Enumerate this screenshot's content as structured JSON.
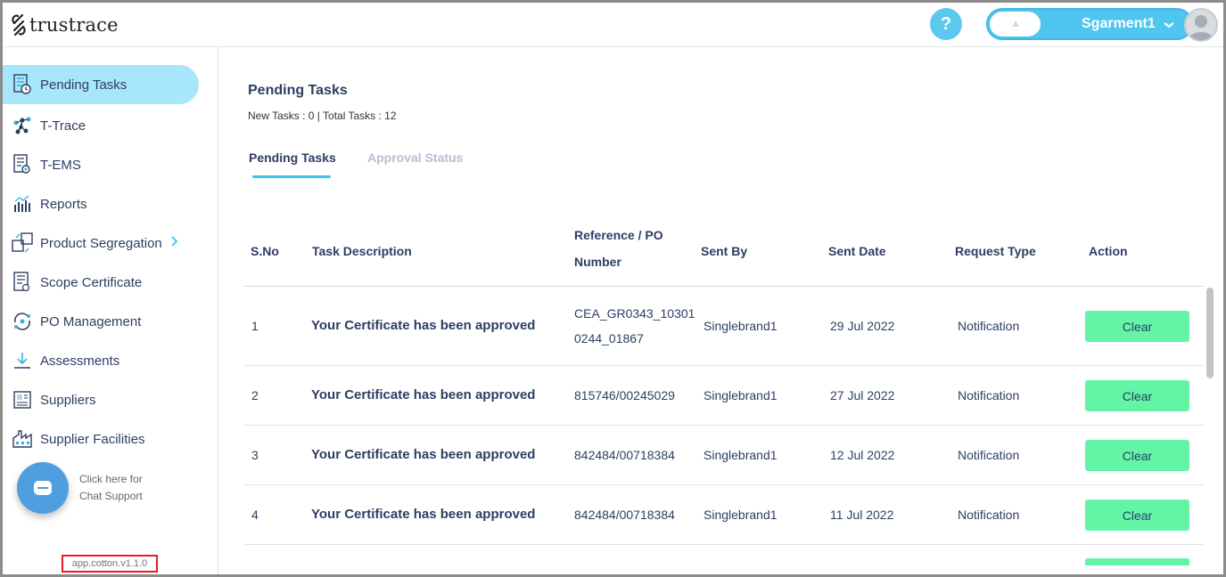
{
  "header": {
    "logo_text": "trustrace",
    "help_label": "?",
    "account_name": "Sgarment1",
    "account_chevron": "chevron-down-icon"
  },
  "sidebar": {
    "items": [
      {
        "label": "Pending Tasks",
        "icon": "clipboard-clock-icon",
        "active": true
      },
      {
        "label": "T-Trace",
        "icon": "network-nodes-icon"
      },
      {
        "label": "T-EMS",
        "icon": "document-badge-icon"
      },
      {
        "label": "Reports",
        "icon": "chart-icon"
      },
      {
        "label": "Product Segregation",
        "icon": "segregation-icon",
        "has_submenu": true
      },
      {
        "label": "Scope Certificate",
        "icon": "certificate-icon"
      },
      {
        "label": "PO Management",
        "icon": "po-cycle-icon"
      },
      {
        "label": "Assessments",
        "icon": "download-icon"
      },
      {
        "label": "Suppliers",
        "icon": "supplier-card-icon"
      },
      {
        "label": "Supplier Facilities",
        "icon": "factory-icon"
      }
    ],
    "chat_line1": "Click here for",
    "chat_line2": "Chat Support",
    "version": "app.cotton.v1.1.0"
  },
  "main": {
    "title": "Pending Tasks",
    "subtitle": "New Tasks : 0 | Total Tasks : 12",
    "tabs": [
      {
        "label": "Pending Tasks",
        "active": true
      },
      {
        "label": "Approval Status",
        "active": false
      }
    ],
    "table": {
      "columns": [
        "S.No",
        "Task Description",
        "Reference / PO",
        "Number",
        "Sent By",
        "Sent Date",
        "Request Type",
        "Action"
      ],
      "rows": [
        {
          "sno": "1",
          "desc": "Your Certificate has been approved",
          "ref1": "CEA_GR0343_10301",
          "ref2": "0244_01867",
          "sent_by": "Singlebrand1",
          "date": "29 Jul 2022",
          "type": "Notification",
          "action": "Clear"
        },
        {
          "sno": "2",
          "desc": "Your Certificate has been approved",
          "ref1": "815746/00245029",
          "ref2": "",
          "sent_by": "Singlebrand1",
          "date": "27 Jul 2022",
          "type": "Notification",
          "action": "Clear"
        },
        {
          "sno": "3",
          "desc": "Your Certificate has been approved",
          "ref1": "842484/00718384",
          "ref2": "",
          "sent_by": "Singlebrand1",
          "date": "12 Jul 2022",
          "type": "Notification",
          "action": "Clear"
        },
        {
          "sno": "4",
          "desc": "Your Certificate has been approved",
          "ref1": "842484/00718384",
          "ref2": "",
          "sent_by": "Singlebrand1",
          "date": "11 Jul 2022",
          "type": "Notification",
          "action": "Clear"
        }
      ]
    }
  },
  "colors": {
    "accent": "#4fc6ef",
    "active_nav": "#a8e6fb",
    "text_primary": "#2d3e63",
    "button_green": "#63f4a6"
  }
}
